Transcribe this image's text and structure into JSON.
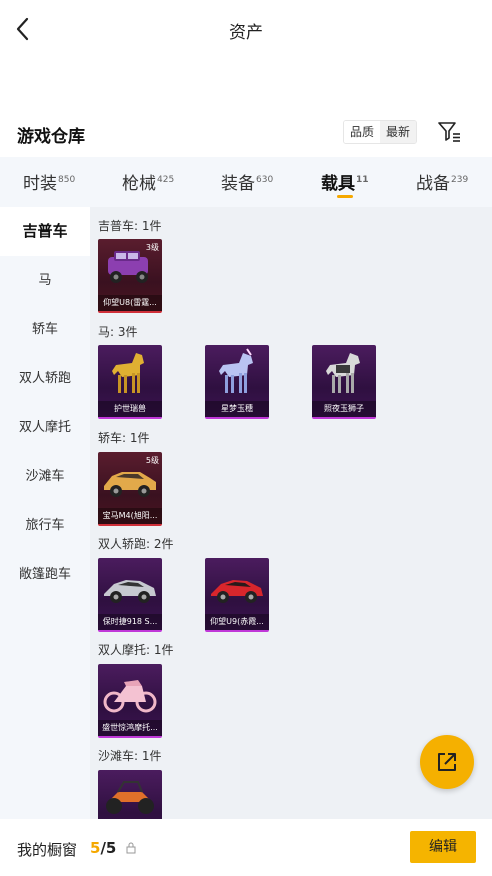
{
  "header": {
    "title": "资产",
    "back_icon": "chevron-left-icon"
  },
  "section": {
    "title": "游戏仓库",
    "sort": {
      "quality": "品质",
      "latest": "最新",
      "selected": "最新"
    },
    "filter_icon": "filter-icon"
  },
  "tabs": [
    {
      "label": "时装",
      "count": "850"
    },
    {
      "label": "枪械",
      "count": "425"
    },
    {
      "label": "装备",
      "count": "630"
    },
    {
      "label": "载具",
      "count": "11"
    },
    {
      "label": "战备",
      "count": "239"
    }
  ],
  "active_tab": "载具",
  "sidebar": [
    {
      "label": "吉普车"
    },
    {
      "label": "马"
    },
    {
      "label": "轿车"
    },
    {
      "label": "双人轿跑"
    },
    {
      "label": "双人摩托"
    },
    {
      "label": "沙滩车"
    },
    {
      "label": "旅行车"
    },
    {
      "label": "敞篷跑车"
    }
  ],
  "groups": [
    {
      "label": "吉普车: 1件",
      "items": [
        {
          "name": "仰望U8(雷霆...",
          "level": "3级",
          "rarity": "red",
          "icon": "jeep-icon"
        }
      ]
    },
    {
      "label": "马: 3件",
      "items": [
        {
          "name": "护世瑞兽",
          "level": "",
          "rarity": "purple",
          "icon": "gold-horse-icon"
        },
        {
          "name": "星梦玉穗",
          "level": "",
          "rarity": "purple",
          "icon": "unicorn-icon"
        },
        {
          "name": "照夜玉狮子",
          "level": "",
          "rarity": "purple",
          "icon": "armored-horse-icon"
        }
      ]
    },
    {
      "label": "轿车: 1件",
      "items": [
        {
          "name": "宝马M4(旭阳...",
          "level": "5级",
          "rarity": "red",
          "icon": "gold-sedan-icon"
        }
      ]
    },
    {
      "label": "双人轿跑: 2件",
      "items": [
        {
          "name": "保时捷918 S...",
          "level": "",
          "rarity": "purple",
          "icon": "silver-coupe-icon"
        },
        {
          "name": "仰望U9(赤霞...",
          "level": "",
          "rarity": "purple",
          "icon": "red-coupe-icon"
        }
      ]
    },
    {
      "label": "双人摩托: 1件",
      "items": [
        {
          "name": "盛世惊鸿摩托...",
          "level": "",
          "rarity": "purple",
          "icon": "pink-motorbike-icon"
        }
      ]
    },
    {
      "label": "沙滩车: 1件",
      "items": [
        {
          "name": "",
          "level": "",
          "rarity": "purple",
          "icon": "buggy-icon"
        }
      ]
    }
  ],
  "bottom": {
    "window_label": "我的橱窗",
    "window_current": "5",
    "window_sep": "/",
    "window_total": "5",
    "lock_icon": "lock-icon",
    "edit_label": "编辑"
  },
  "fab": {
    "icon": "share-external-icon"
  },
  "colors": {
    "accent": "#f5b400",
    "red_rarity": "#d0303a",
    "purple_rarity": "#c038d8",
    "panel_bg": "#f4f7fb"
  }
}
